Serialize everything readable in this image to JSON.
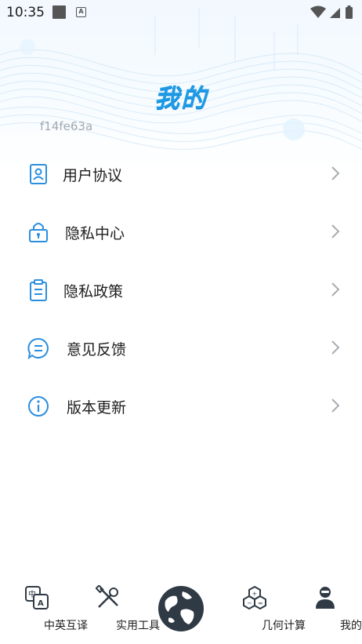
{
  "status_bar": {
    "time": "10:35"
  },
  "header": {
    "title": "我的",
    "user_id": "f14fe63a"
  },
  "menu": [
    {
      "label": "用户协议",
      "icon": "user-agreement-icon"
    },
    {
      "label": "隐私中心",
      "icon": "lock-icon"
    },
    {
      "label": "隐私政策",
      "icon": "clipboard-icon"
    },
    {
      "label": "意见反馈",
      "icon": "chat-icon"
    },
    {
      "label": "版本更新",
      "icon": "info-icon"
    }
  ],
  "bottom_nav": [
    {
      "label": "中英互译",
      "icon": "translate-icon"
    },
    {
      "label": "实用工具",
      "icon": "tools-icon"
    },
    {
      "label": "",
      "icon": "globe-icon"
    },
    {
      "label": "几何计算",
      "icon": "geometry-icon"
    },
    {
      "label": "我的",
      "icon": "profile-icon"
    }
  ],
  "colors": {
    "accent": "#1f9be6",
    "icon": "#2b8fe0",
    "text": "#1e1e1e",
    "muted": "#a3a9af",
    "nav_dark": "#2f3a45"
  }
}
